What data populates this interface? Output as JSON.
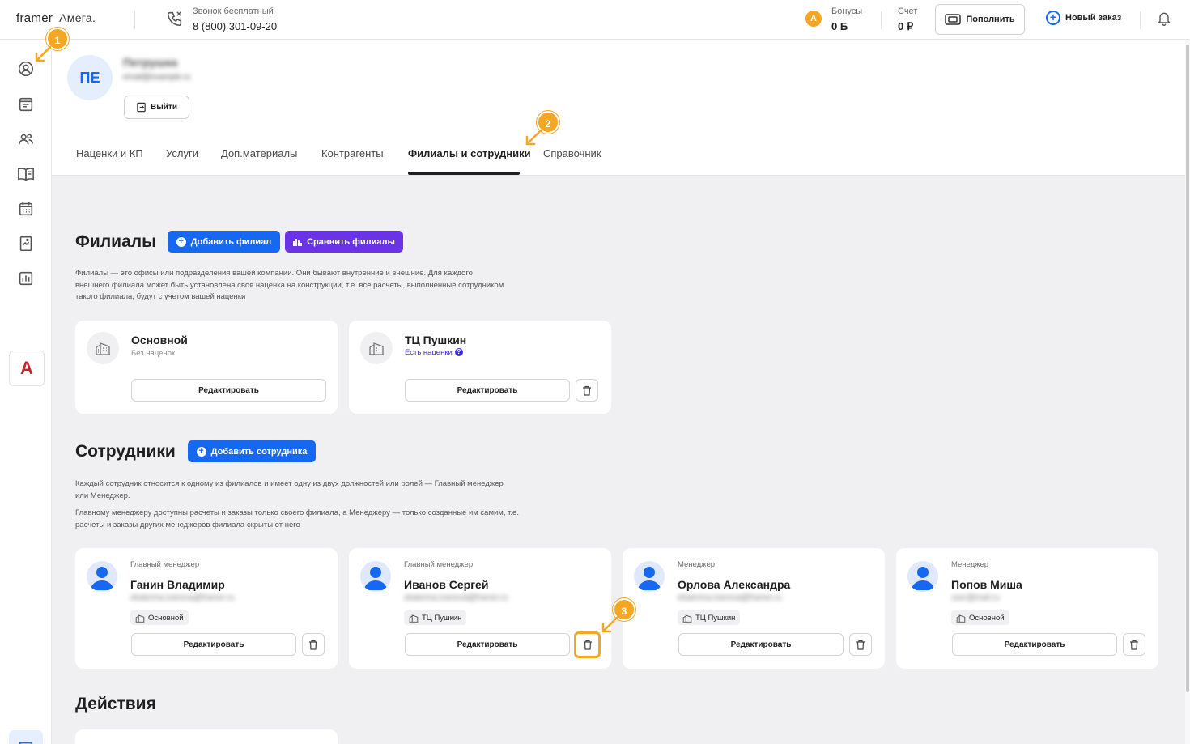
{
  "header": {
    "logo_framer": "framer",
    "logo_amega": "Амега.",
    "phone_label": "Звонок бесплатный",
    "phone_number": "8 (800) 301-09-20",
    "bonus_label": "Бонусы",
    "bonus_value": "0 Б",
    "account_label": "Счет",
    "account_value": "0 ₽",
    "topup_label": "Пополнить",
    "new_order_label": "Новый заказ"
  },
  "profile": {
    "initials": "ПЕ",
    "name": "Петрушка",
    "email": "email@example.ru",
    "logout_label": "Выйти"
  },
  "tabs": [
    {
      "label": "Наценки и КП"
    },
    {
      "label": "Услуги"
    },
    {
      "label": "Доп.материалы"
    },
    {
      "label": "Контрагенты"
    },
    {
      "label": "Филиалы и сотрудники"
    },
    {
      "label": "Справочник"
    }
  ],
  "branches": {
    "title": "Филиалы",
    "add_label": "Добавить филиал",
    "compare_label": "Сравнить филиалы",
    "description": "Филиалы — это офисы или подразделения вашей компании. Они бывают внутренние и внешние. Для каждого внешнего филиала может быть установлена своя наценка на конструкции, т.е. все расчеты, выполненные сотрудником такого филиала, будут с учетом вашей наценки",
    "items": [
      {
        "name": "Основной",
        "sub": "Без наценок",
        "edit": "Редактировать"
      },
      {
        "name": "ТЦ Пушкин",
        "sub": "Есть наценки",
        "edit": "Редактировать"
      }
    ]
  },
  "employees": {
    "title": "Сотрудники",
    "add_label": "Добавить сотрудника",
    "desc1": "Каждый сотрудник относится к одному из филиалов и имеет одну из двух должностей или ролей — Главный менеджер или Менеджер.",
    "desc2": "Главному менеджеру доступны расчеты и заказы только своего филиала, а Менеджеру — только созданные им самим, т.е. расчеты и заказы других менеджеров филиала скрыты от него",
    "items": [
      {
        "role": "Главный менеджер",
        "name": "Ганин Владимир",
        "email": "ekaterina.ivanova@framer.ru",
        "branch": "Основной",
        "edit": "Редактировать"
      },
      {
        "role": "Главный менеджер",
        "name": "Иванов Сергей",
        "email": "ekaterina.ivanova@framer.ru",
        "branch": "ТЦ Пушкин",
        "edit": "Редактировать"
      },
      {
        "role": "Менеджер",
        "name": "Орлова Александра",
        "email": "ekaterina.ivanova@framer.ru",
        "branch": "ТЦ Пушкин",
        "edit": "Редактировать"
      },
      {
        "role": "Менеджер",
        "name": "Попов Миша",
        "email": "user@mail.ru",
        "branch": "Основной",
        "edit": "Редактировать"
      }
    ]
  },
  "actions": {
    "title": "Действия"
  },
  "markers": [
    "1",
    "2",
    "3"
  ],
  "colors": {
    "accent": "#1668f0",
    "purple": "#6a33e6",
    "marker": "#f5a623",
    "brand_red": "#c1272d"
  },
  "icons": [
    "profile-icon",
    "orders-icon",
    "clients-icon",
    "catalog-icon",
    "calendar-icon",
    "gallery-icon",
    "analytics-icon",
    "chat-icon",
    "bell-icon",
    "phone-icon",
    "wallet-icon",
    "building-icon",
    "trash-icon",
    "logout-icon"
  ]
}
